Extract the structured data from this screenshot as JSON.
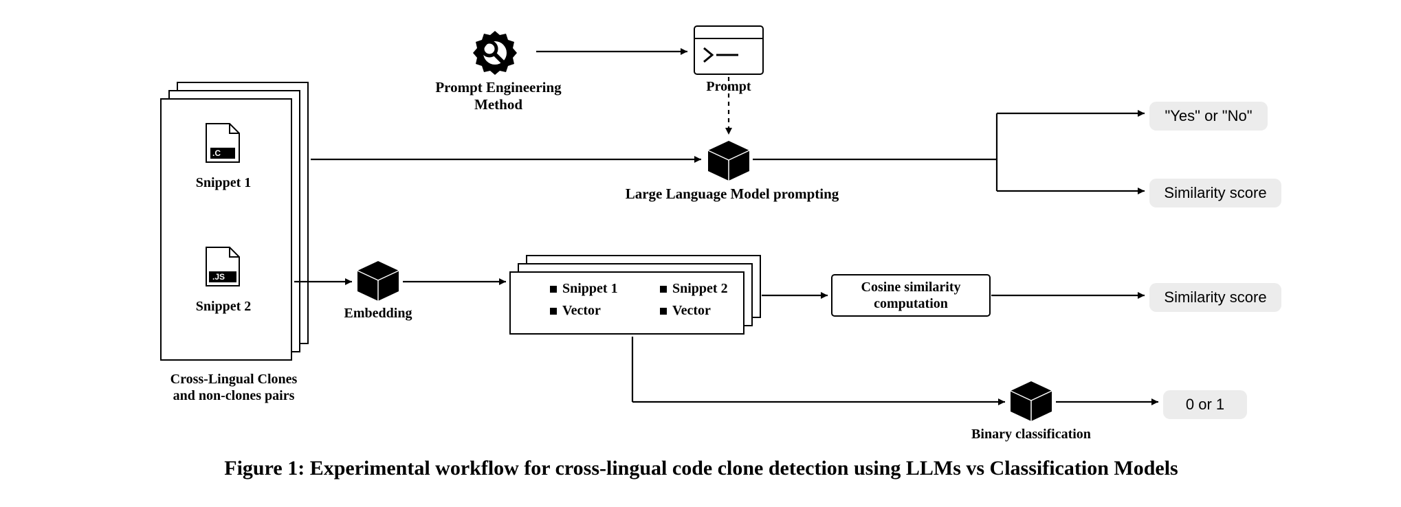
{
  "caption": "Figure 1: Experimental workflow for cross-lingual code clone detection using LLMs vs Classification Models",
  "inputs": {
    "snippet1_label": "Snippet 1",
    "snippet2_label": "Snippet 2",
    "file1_ext": ".C",
    "file2_ext": ".JS",
    "pairs_label": "Cross-Lingual Clones\nand non-clones pairs"
  },
  "prompt_engineering": {
    "label": "Prompt Engineering\nMethod",
    "prompt_label": "Prompt"
  },
  "llm": {
    "label": "Large Language Model prompting"
  },
  "embedding": {
    "label": "Embedding"
  },
  "vectors": {
    "col1_top": "Snippet 1",
    "col1_bot": "Vector",
    "col2_top": "Snippet 2",
    "col2_bot": "Vector"
  },
  "cosine": {
    "label": "Cosine similarity\ncomputation"
  },
  "binary": {
    "label": "Binary classification"
  },
  "outputs": {
    "yes_no": "\"Yes\" or \"No\"",
    "sim_score": "Similarity score",
    "sim_score2": "Similarity score",
    "zero_one": "0 or 1"
  }
}
